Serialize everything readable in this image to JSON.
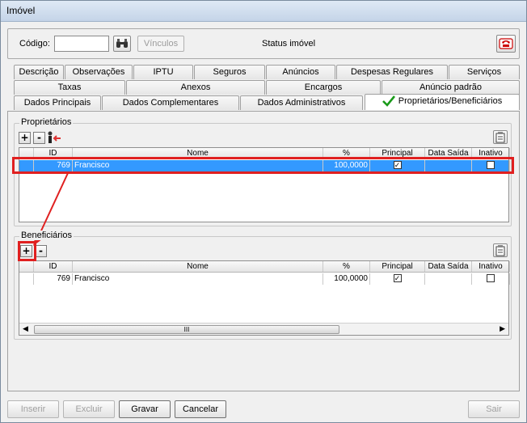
{
  "window": {
    "title": "Imóvel"
  },
  "top": {
    "codigo_label": "Código:",
    "codigo_value": "",
    "vinculos_label": "Vínculos",
    "status_label": "Status imóvel"
  },
  "tabs": {
    "row1": [
      "Descrição",
      "Observações",
      "IPTU",
      "Seguros",
      "Anúncios",
      "Despesas Regulares",
      "Serviços"
    ],
    "row2": [
      "Taxas",
      "Anexos",
      "Encargos",
      "Anúncio padrão"
    ],
    "row3": [
      "Dados Principais",
      "Dados Complementares",
      "Dados Administrativos",
      "Proprietários/Beneficiários"
    ]
  },
  "proprietarios": {
    "title": "Proprietários",
    "add": "+",
    "remove": "-",
    "columns": [
      "ID",
      "Nome",
      "%",
      "Principal",
      "Data Saída",
      "Inativo"
    ],
    "rows": [
      {
        "id": "769",
        "nome": "Francisco",
        "pct": "100,0000",
        "principal": true,
        "data_saida": "",
        "inativo": false
      }
    ]
  },
  "beneficiarios": {
    "title": "Beneficiários",
    "add": "+",
    "remove": "-",
    "columns": [
      "ID",
      "Nome",
      "%",
      "Principal",
      "Data Saída",
      "Inativo"
    ],
    "rows": [
      {
        "id": "769",
        "nome": "Francisco",
        "pct": "100,0000",
        "principal": true,
        "data_saida": "",
        "inativo": false
      }
    ],
    "scroll_thumb": "III"
  },
  "footer": {
    "inserir": "Inserir",
    "excluir": "Excluir",
    "gravar": "Gravar",
    "cancelar": "Cancelar",
    "sair": "Sair"
  },
  "colors": {
    "selection": "#3399ff",
    "annotation": "#e02020",
    "check": "#1a9a1a"
  }
}
